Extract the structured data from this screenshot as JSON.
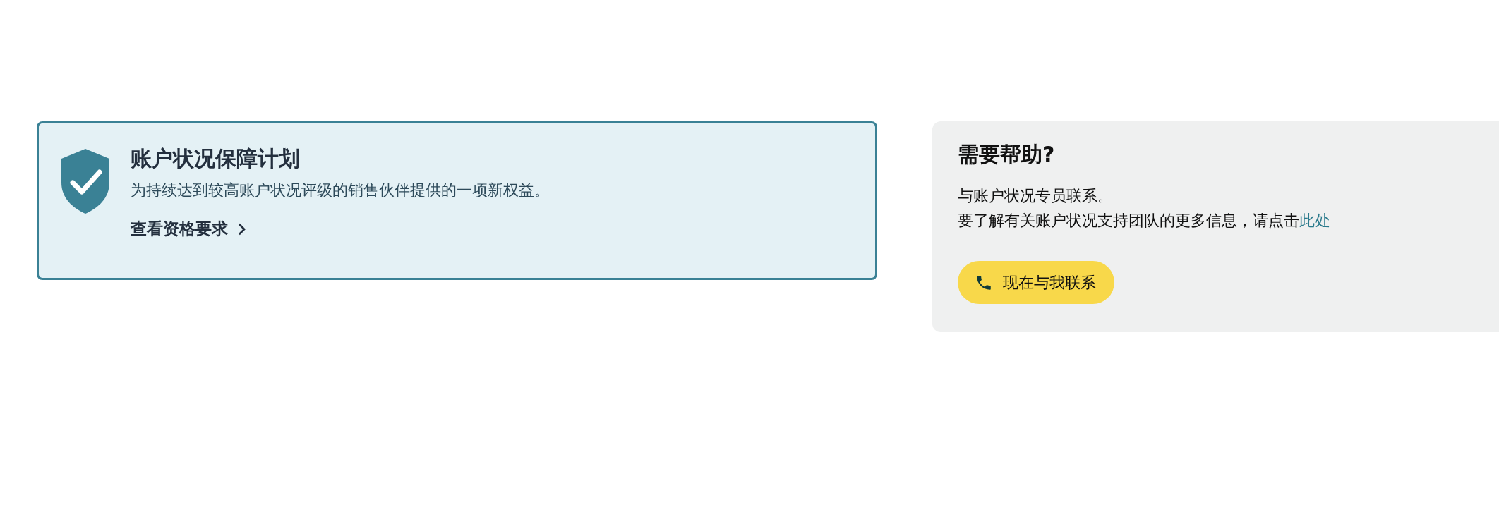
{
  "program_card": {
    "title": "账户状况保障计划",
    "description": "为持续达到较高账户状况评级的销售伙伴提供的一项新权益。",
    "link": "查看资格要求"
  },
  "help_panel": {
    "title": "需要帮助?",
    "lines": [
      "与账户状况专员联系。"
    ],
    "info": {
      "text": "要了解有关账户状况支持团队的更多信息，请点击",
      "link": "此处"
    },
    "button": "现在与我联系"
  }
}
